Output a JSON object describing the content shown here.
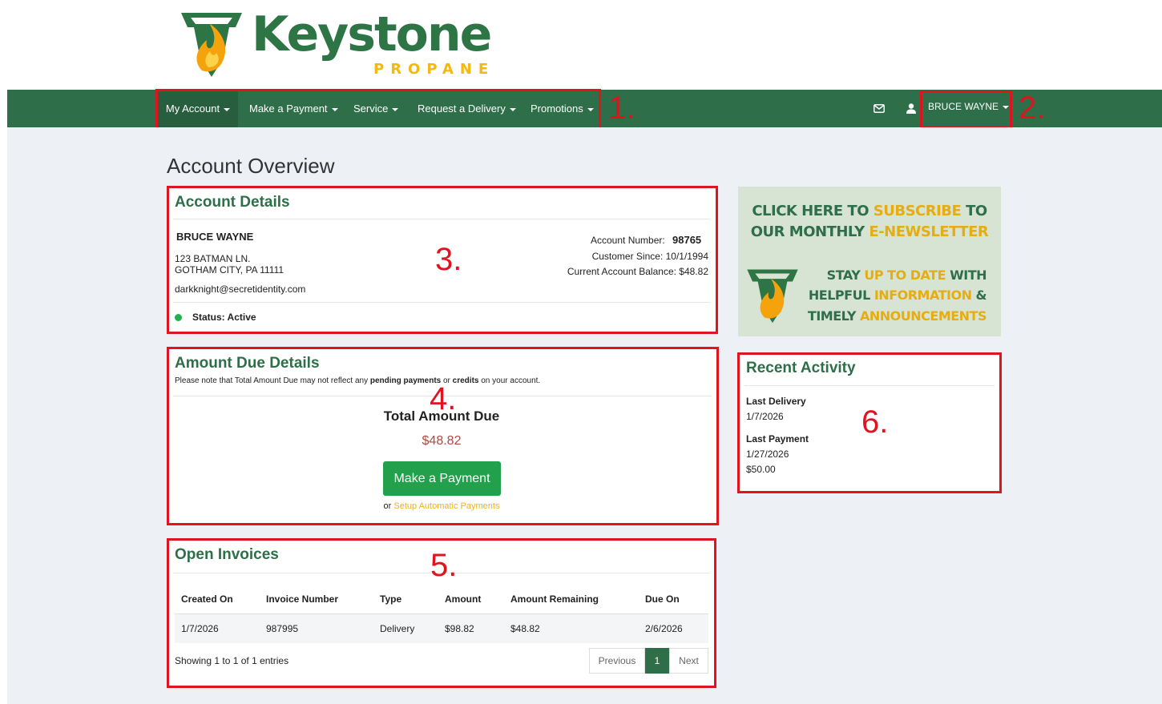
{
  "brand": {
    "name": "Keystone",
    "sub": "PROPANE",
    "colors": {
      "green": "#2e6f49",
      "gold": "#f5b80d",
      "annotation": "#e0141e"
    }
  },
  "nav": {
    "items": [
      "My Account",
      "Make a Payment",
      "Service",
      "Request a Delivery",
      "Promotions"
    ],
    "mail_icon": "envelope-icon",
    "user_icon": "user-icon",
    "user_name": "BRUCE WAYNE"
  },
  "annotations": [
    "1.",
    "2.",
    "3.",
    "4.",
    "5.",
    "6."
  ],
  "page_title": "Account Overview",
  "account_details": {
    "title": "Account Details",
    "name": "BRUCE WAYNE",
    "address_line1": "123 BATMAN LN.",
    "address_line2": "GOTHAM CITY, PA 11111",
    "email": "darkknight@secretidentity.com",
    "status": "Status: Active",
    "account_number_label": "Account Number:",
    "account_number": "98765",
    "customer_since": "Customer Since: 10/1/1994",
    "balance": "Current Account Balance: $48.82"
  },
  "amount_due": {
    "title": "Amount Due Details",
    "note_pre": "Please note that Total Amount Due may not reflect any ",
    "note_b1": "pending payments",
    "note_mid": " or ",
    "note_b2": "credits",
    "note_post": " on your account.",
    "total_label": "Total Amount Due",
    "total_value": "$48.82",
    "pay_button": "Make a Payment",
    "or_text": "or",
    "autopay_link": "Setup Automatic Payments"
  },
  "invoices": {
    "title": "Open Invoices",
    "columns": [
      "Created On",
      "Invoice Number",
      "Type",
      "Amount",
      "Amount Remaining",
      "Due On"
    ],
    "rows": [
      [
        "1/7/2026",
        "987995",
        "Delivery",
        "$98.82",
        "$48.82",
        "2/6/2026"
      ]
    ],
    "showing": "Showing 1 to 1 of 1 entries",
    "pager": {
      "prev": "Previous",
      "page": "1",
      "next": "Next"
    }
  },
  "promo": {
    "line1a": "CLICK HERE TO ",
    "line1b": "SUBSCRIBE",
    "line1c": " TO",
    "line2a": "OUR MONTHLY ",
    "line2b": "E-NEWSLETTER",
    "line3a": "STAY ",
    "line3b": "UP TO DATE",
    "line3c": " WITH",
    "line4a": "HELPFUL ",
    "line4b": "INFORMATION",
    "line4c": " &",
    "line5a": "TIMELY ",
    "line5b": "ANNOUNCEMENTS"
  },
  "recent_activity": {
    "title": "Recent Activity",
    "last_delivery_label": "Last Delivery",
    "last_delivery_date": "1/7/2026",
    "last_payment_label": "Last Payment",
    "last_payment_date": "1/27/2026",
    "last_payment_amount": "$50.00"
  }
}
